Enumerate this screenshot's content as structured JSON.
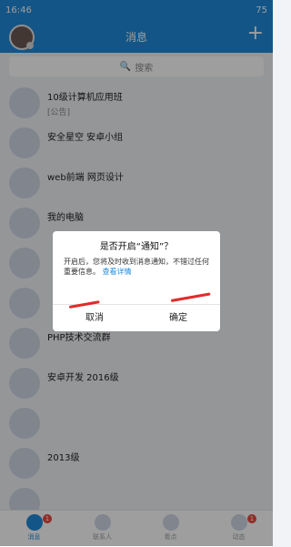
{
  "statusbar": {
    "left": "16:46",
    "right": "75"
  },
  "header": {
    "title": "消息",
    "plus": "+"
  },
  "search": {
    "placeholder": "搜索"
  },
  "list": [
    {
      "title": "10级计算机应用班",
      "subtitle": "[公告]",
      "time": "",
      "badge": ""
    },
    {
      "title": "安全星空 安卓小组",
      "subtitle": "",
      "time": "",
      "badge": ""
    },
    {
      "title": "web前端 网页设计",
      "subtitle": "",
      "time": "",
      "badge": ""
    },
    {
      "title": "我的电脑",
      "subtitle": "",
      "time": "",
      "badge": ""
    },
    {
      "title": "",
      "subtitle": "",
      "time": "",
      "badge": ""
    },
    {
      "title": "",
      "subtitle": "",
      "time": "",
      "badge": ""
    },
    {
      "title": "PHP技术交流群",
      "subtitle": "",
      "time": "",
      "badge": ""
    },
    {
      "title": "安卓开发 2016级",
      "subtitle": "",
      "time": "",
      "badge": ""
    },
    {
      "title": "",
      "subtitle": "",
      "time": "",
      "badge": ""
    },
    {
      "title": "2013级",
      "subtitle": "",
      "time": "",
      "badge": ""
    },
    {
      "title": "",
      "subtitle": "",
      "time": "",
      "badge": ""
    }
  ],
  "dialog": {
    "title": "是否开启“通知”？",
    "body": "开启后，您将及时收到消息通知，不错过任何重要信息。",
    "link": "查看详情",
    "cancel": "取消",
    "ok": "确定"
  },
  "tabs": [
    {
      "label": "消息",
      "badge": "1"
    },
    {
      "label": "联系人",
      "badge": ""
    },
    {
      "label": "看点",
      "badge": ""
    },
    {
      "label": "动态",
      "badge": "1"
    }
  ]
}
